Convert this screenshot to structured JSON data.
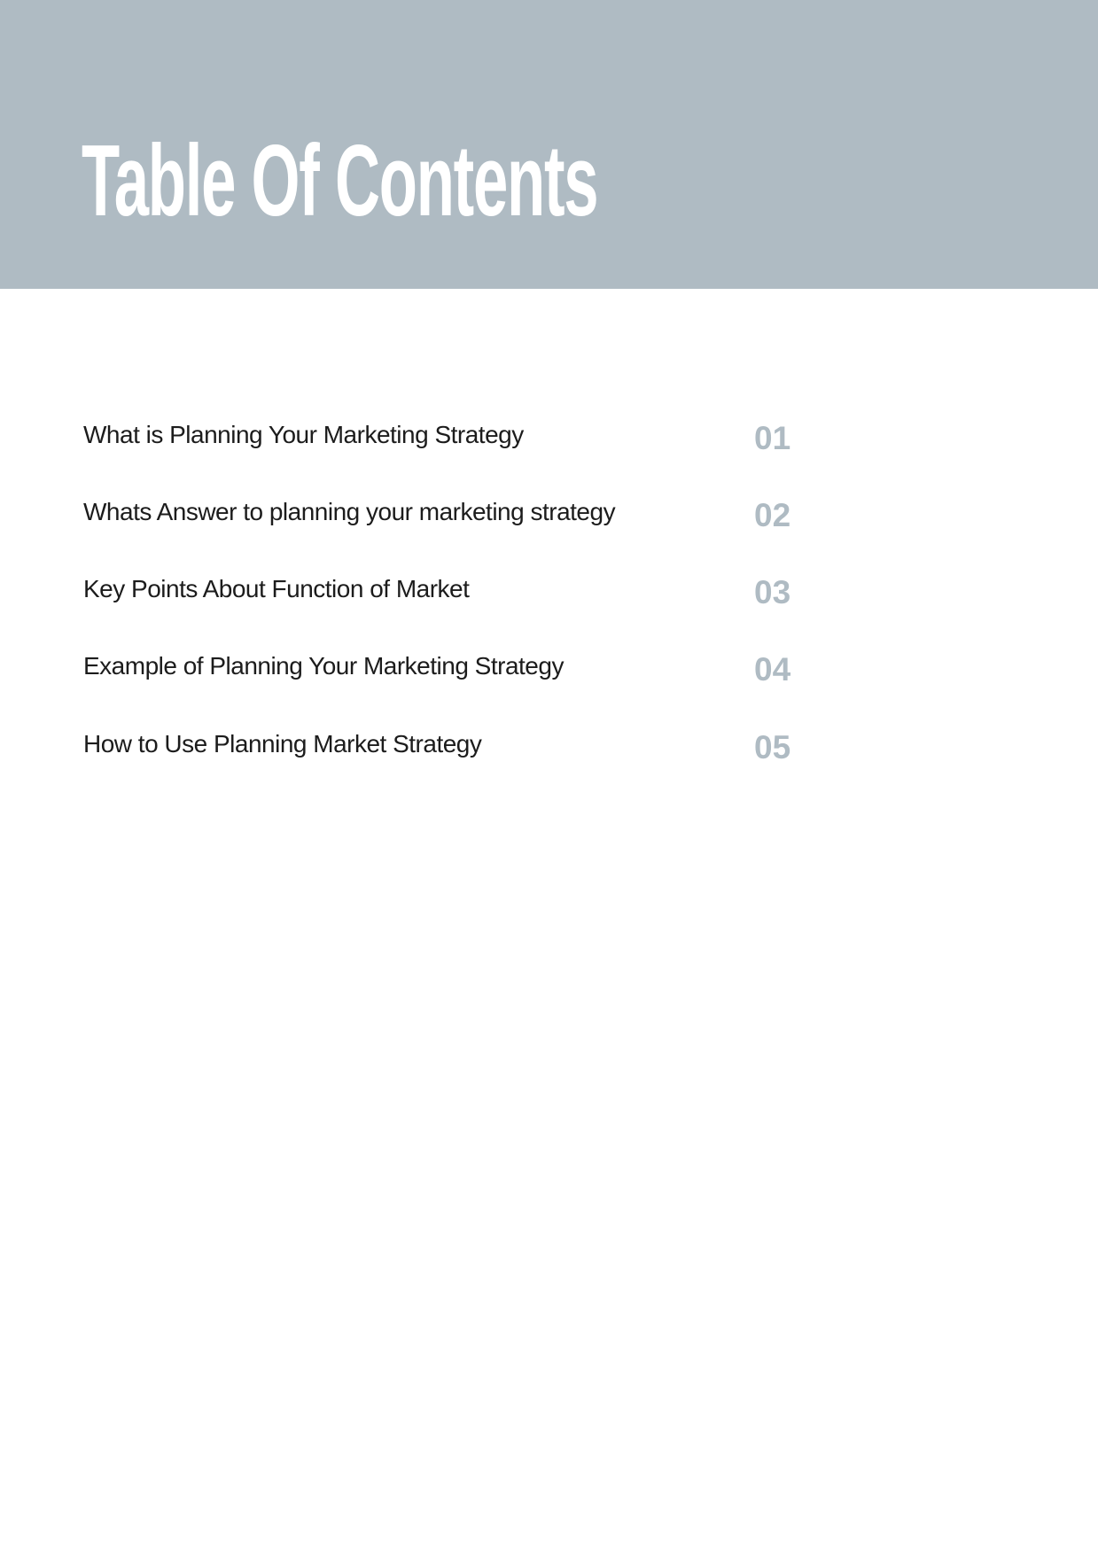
{
  "header": {
    "title": "Table Of Contents",
    "band_color": "#afbbc3"
  },
  "toc": {
    "number_color": "#afbbc3",
    "entries": [
      {
        "title": "What is Planning Your Marketing Strategy",
        "number": "01"
      },
      {
        "title": "Whats Answer to planning your marketing strategy",
        "number": "02"
      },
      {
        "title": "Key Points About Function of Market",
        "number": "03"
      },
      {
        "title": "Example of Planning Your Marketing Strategy",
        "number": "04"
      },
      {
        "title": "How to Use Planning Market Strategy",
        "number": "05"
      }
    ]
  }
}
